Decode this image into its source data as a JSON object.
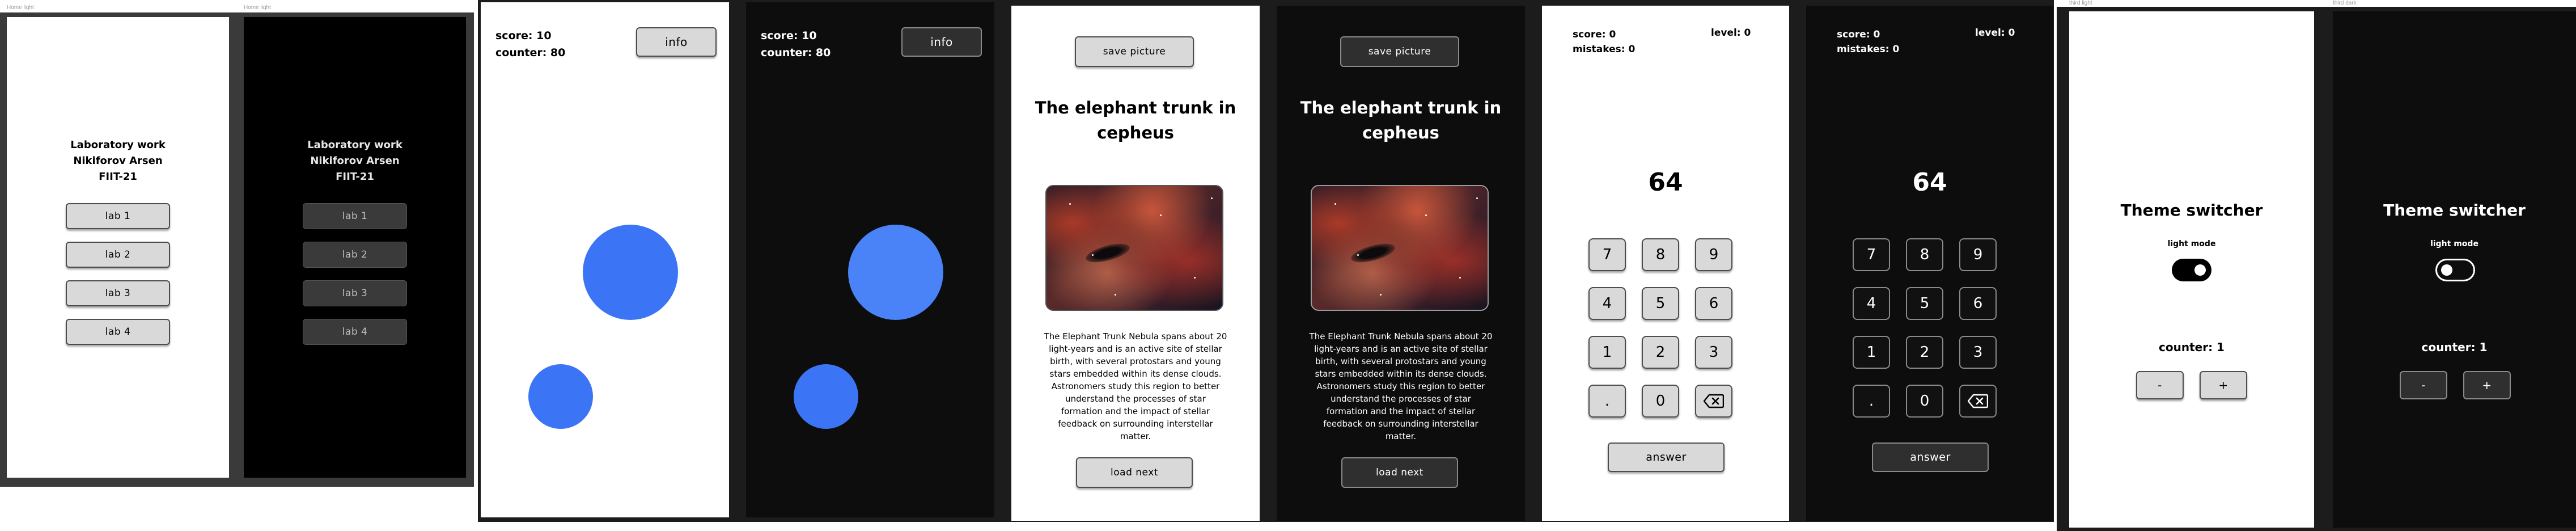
{
  "labels": {
    "home_light": "Home light",
    "home_dark": "Home light",
    "third_light": "third light",
    "third_dark": "third dark"
  },
  "home": {
    "title_line1": "Laboratory work",
    "title_line2": "Nikiforov Arsen",
    "title_line3": "FIIT-21",
    "buttons": [
      "lab 1",
      "lab 2",
      "lab 3",
      "lab 4"
    ]
  },
  "circles_game": {
    "score": "score: 10",
    "counter": "counter: 80",
    "info_button": "info",
    "circle_color": "#3b75f5"
  },
  "picture": {
    "save_button": "save picture",
    "title_line1": "The elephant trunk in",
    "title_line2": "cepheus",
    "paragraph": [
      "The Elephant Trunk Nebula spans about 20",
      "light-years and is an active site of stellar",
      "birth, with several protostars and young",
      "stars embedded within its dense clouds.",
      "Astronomers study this region to better",
      "understand the processes of star",
      "formation and the impact of stellar",
      "feedback on surrounding interstellar",
      "matter."
    ],
    "load_button": "load next"
  },
  "quiz": {
    "score": "score: 0",
    "mistakes": "mistakes: 0",
    "level": "level: 0",
    "number": "64",
    "keys": [
      "7",
      "8",
      "9",
      "4",
      "5",
      "6",
      "1",
      "2",
      "3",
      ".",
      "0"
    ],
    "backspace_icon": "backspace-icon",
    "answer_button": "answer"
  },
  "theme": {
    "title": "Theme switcher",
    "mode_label": "light mode",
    "counter": "counter: 1",
    "minus": "-",
    "plus": "+"
  }
}
